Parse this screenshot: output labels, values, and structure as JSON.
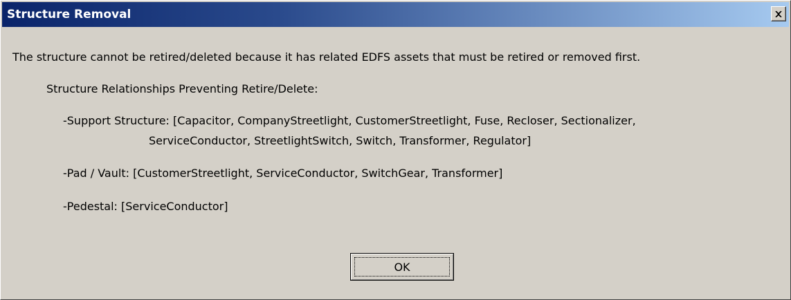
{
  "window": {
    "title": "Structure Removal",
    "close_icon": "close-icon"
  },
  "dialog": {
    "message": "The structure cannot be retired/deleted because it has related EDFS assets that must be retired or removed first.",
    "relationships_heading": "Structure Relationships Preventing Retire/Delete:",
    "relationships": [
      {
        "line1": "-Support Structure: [Capacitor, CompanyStreetlight, CustomerStreetlight, Fuse, Recloser, Sectionalizer,",
        "line2": "ServiceConductor, StreetlightSwitch, Switch, Transformer, Regulator]"
      },
      {
        "line1": "-Pad / Vault: [CustomerStreetlight, ServiceConductor, SwitchGear, Transformer]"
      },
      {
        "line1": "-Pedestal: [ServiceConductor]"
      }
    ],
    "ok_label": "OK"
  },
  "colors": {
    "face": "#d4d0c8",
    "title_start": "#0a246a",
    "title_end": "#a6caf0",
    "title_text": "#ffffff"
  }
}
